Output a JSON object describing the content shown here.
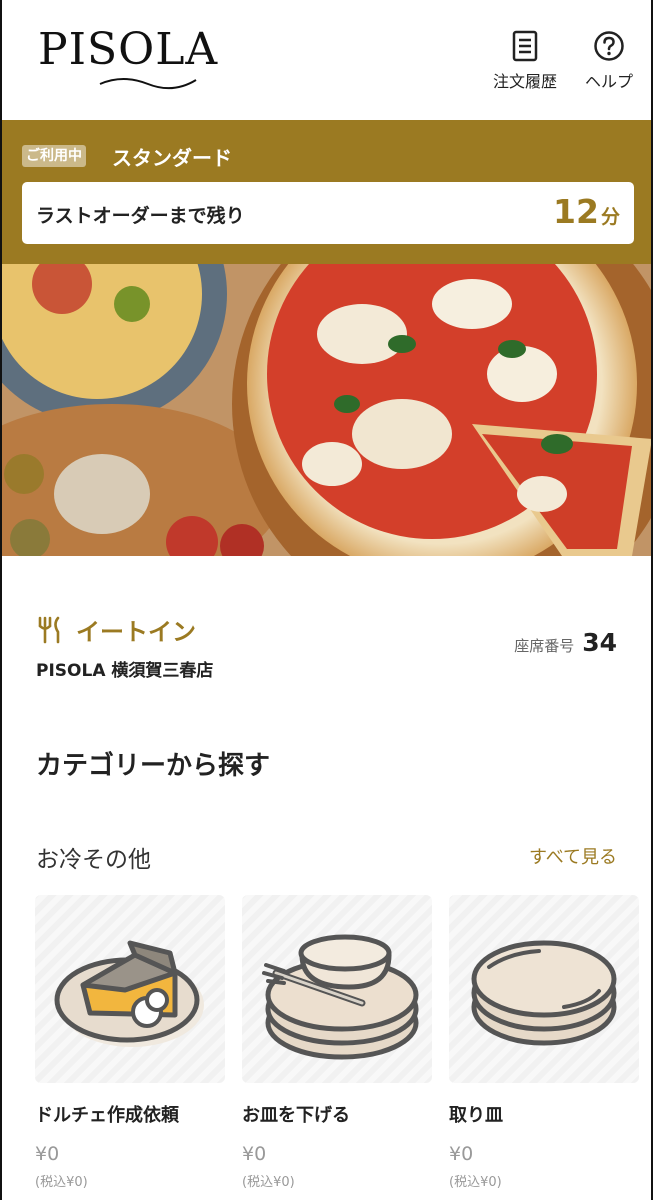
{
  "header": {
    "logo": "PISOLA",
    "order_history_label": "注文履歴",
    "help_label": "ヘルプ"
  },
  "plan": {
    "badge": "ご利用中",
    "name": "スタンダード",
    "last_order_label": "ラストオーダーまで残り",
    "last_order_value": "12",
    "last_order_unit": "分"
  },
  "info": {
    "mode": "イートイン",
    "store": "PISOLA 横須賀三春店",
    "seat_label": "座席番号",
    "seat_number": "34"
  },
  "section_title": "カテゴリーから探す",
  "category": {
    "title": "お冷その他",
    "see_all": "すべて見る",
    "items": [
      {
        "name": "ドルチェ作成依頼",
        "price": "¥0",
        "tax": "(税込¥0)"
      },
      {
        "name": "お皿を下げる",
        "price": "¥0",
        "tax": "(税込¥0)"
      },
      {
        "name": "取り皿",
        "price": "¥0",
        "tax": "(税込¥0)"
      }
    ]
  },
  "colors": {
    "accent": "#9b7a22",
    "badge_bg": "#cbb98a"
  }
}
